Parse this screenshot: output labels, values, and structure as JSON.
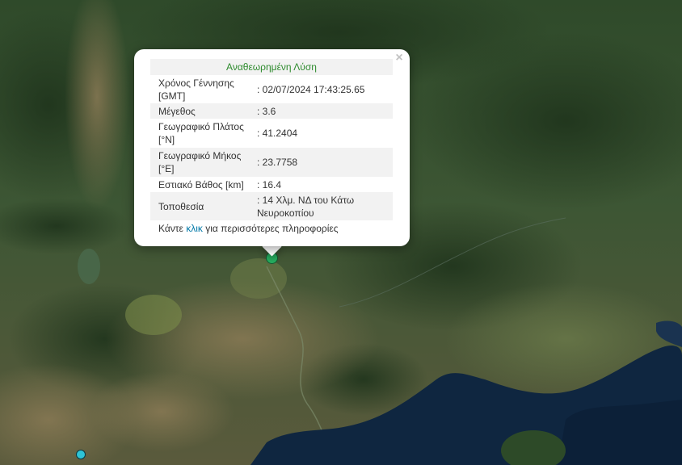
{
  "popup": {
    "title": "Αναθεωρημένη Λύση",
    "close_symbol": "×",
    "rows": [
      {
        "label": "Χρόνος Γέννησης [GMT]",
        "value": ": 02/07/2024 17:43:25.65"
      },
      {
        "label": "Μέγεθος",
        "value": ": 3.6"
      },
      {
        "label": "Γεωγραφικό Πλάτος [°N]",
        "value": ": 41.2404"
      },
      {
        "label": "Γεωγραφικό Μήκος [°E]",
        "value": ": 23.7758"
      },
      {
        "label": "Εστιακό Βάθος [km]",
        "value": ": 16.4"
      },
      {
        "label": "Τοποθεσία",
        "value": ": 14 Χλμ. ΝΔ του Κάτω Νευροκοπίου"
      }
    ],
    "more_prefix": "Κάντε ",
    "more_link": "κλικ",
    "more_suffix": " για περισσότερες πληροφορίες"
  },
  "colors": {
    "title_green": "#2e8b2e",
    "link_blue": "#0078a8",
    "marker_main": "#27ae60",
    "marker_secondary": "#2ec4d6",
    "sea": "#0f2640"
  },
  "icons": {
    "close": "close-icon",
    "marker_main": "earthquake-marker-icon",
    "marker_secondary": "earthquake-marker-icon"
  }
}
